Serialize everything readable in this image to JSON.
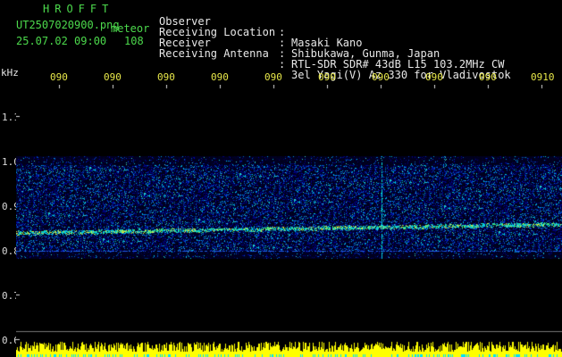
{
  "header": {
    "brand": "HROFFT",
    "filename": "UT2507020900.png",
    "mode": "meteor",
    "datetime": "25.07.02 09:00",
    "count": "108"
  },
  "info": [
    {
      "label": "Observer",
      "value": "Masaki Kano"
    },
    {
      "label": "Receiving Location",
      "value": "Shibukawa, Gunma, Japan"
    },
    {
      "label": "Receiver",
      "value": "RTL-SDR SDR# 43dB L15 103.2MHz CW"
    },
    {
      "label": "Receiving Antenna",
      "value": "3el Yagi(V) Az 330 for Vladivostok"
    }
  ],
  "axes": {
    "unit": "kHz",
    "x_ticks": [
      "090",
      "090",
      "090",
      "090",
      "090",
      "090",
      "090",
      "090",
      "090",
      "0910"
    ],
    "y_ticks": [
      "1.1",
      "1.0",
      "0.9",
      "0.8",
      "0.7",
      "0.6"
    ]
  },
  "colors": {
    "brand": "#4cd94c",
    "tick": "#e8e84a",
    "trace": "#00e0ff",
    "histogram": "#ffff00"
  }
}
